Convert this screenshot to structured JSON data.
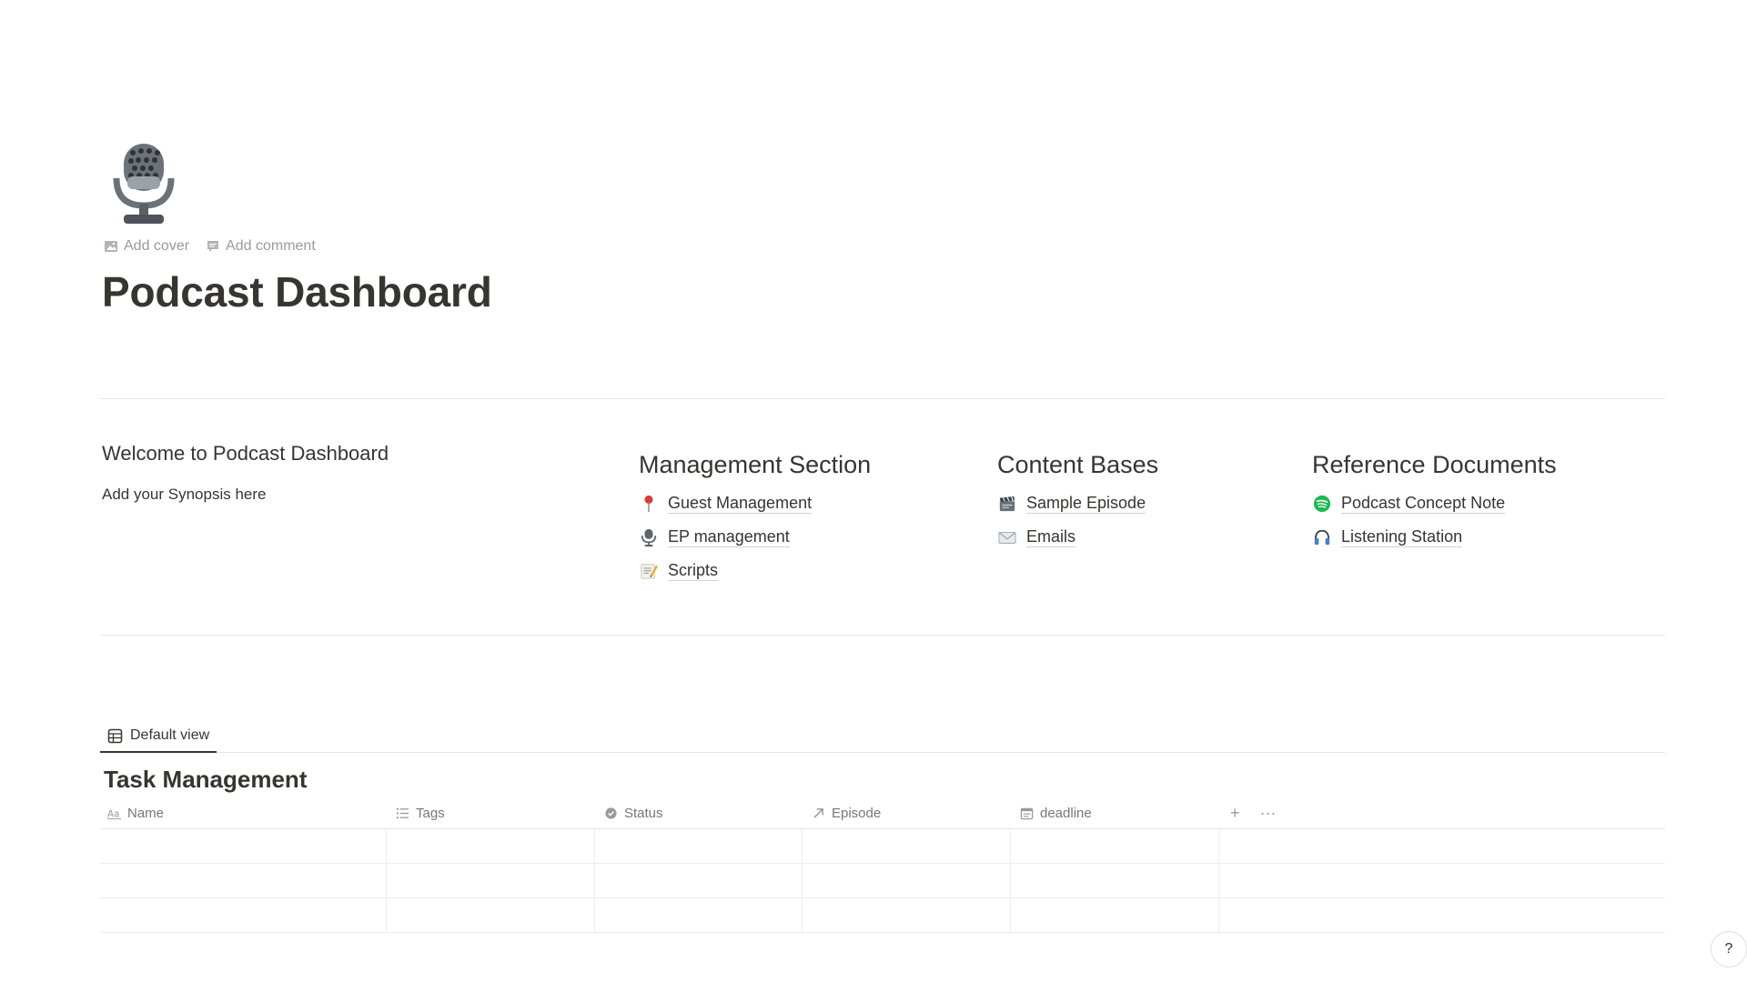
{
  "page": {
    "icon": "microphone-icon",
    "actions": {
      "add_cover": "Add cover",
      "add_comment": "Add comment"
    },
    "title": "Podcast Dashboard"
  },
  "welcome": {
    "heading": "Welcome to Podcast Dashboard",
    "body": "Add your Synopsis here"
  },
  "sections": [
    {
      "heading": "Management Section",
      "links": [
        {
          "icon": "pushpin-icon",
          "label": "Guest Management"
        },
        {
          "icon": "microphone-icon",
          "label": "EP management"
        },
        {
          "icon": "memo-icon",
          "label": "Scripts"
        }
      ]
    },
    {
      "heading": "Content Bases",
      "links": [
        {
          "icon": "clapper-icon",
          "label": "Sample Episode"
        },
        {
          "icon": "envelope-icon",
          "label": "Emails"
        }
      ]
    },
    {
      "heading": "Reference Documents",
      "links": [
        {
          "icon": "spotify-icon",
          "label": "Podcast Concept Note"
        },
        {
          "icon": "headphones-icon",
          "label": "Listening Station"
        }
      ]
    }
  ],
  "database": {
    "view_tab": "Default view",
    "title": "Task Management",
    "columns": [
      {
        "icon": "text-icon",
        "label": "Name"
      },
      {
        "icon": "list-icon",
        "label": "Tags"
      },
      {
        "icon": "status-icon",
        "label": "Status"
      },
      {
        "icon": "relation-arrow-icon",
        "label": "Episode"
      },
      {
        "icon": "calendar-icon",
        "label": "deadline"
      }
    ],
    "add_property": "+",
    "more": "···"
  },
  "help": "?",
  "colors": {
    "text": "#37352f",
    "muted": "#9b9a97",
    "divider": "#e6e5e2",
    "spotify": "#1db954"
  }
}
